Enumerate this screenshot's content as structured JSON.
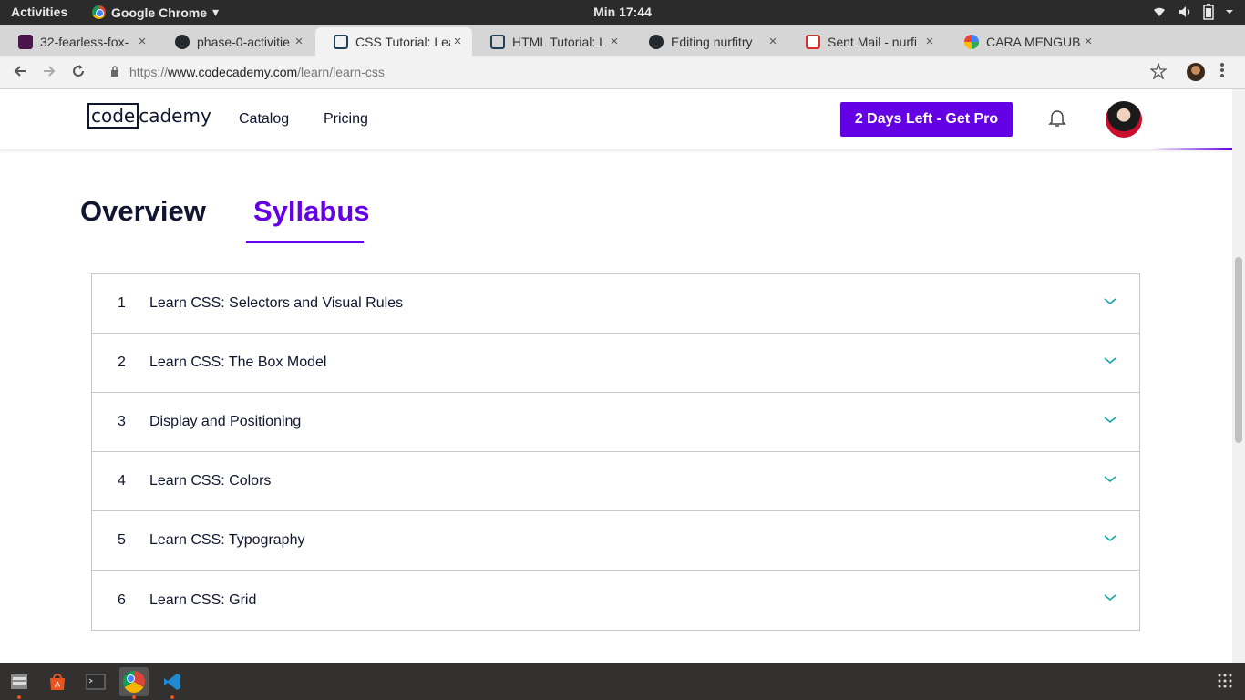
{
  "topbar": {
    "activities": "Activities",
    "app_name": "Google Chrome",
    "app_menu_arrow": "▾",
    "clock": "Min 17:44",
    "icons": [
      "wifi-icon",
      "volume-icon",
      "battery-icon",
      "system-menu-icon"
    ]
  },
  "browser": {
    "tabs": [
      {
        "label": "32-fearless-fox-",
        "icon": "slack-icon"
      },
      {
        "label": "phase-0-activitie",
        "icon": "github-icon"
      },
      {
        "label": "CSS Tutorial: Lea",
        "icon": "codecademy-icon",
        "active": true
      },
      {
        "label": "HTML Tutorial: L",
        "icon": "codecademy-icon"
      },
      {
        "label": "Editing nurfitry",
        "icon": "github-icon"
      },
      {
        "label": "Sent Mail - nurfi",
        "icon": "gmail-icon"
      },
      {
        "label": "CARA MENGUBA",
        "icon": "google-icon"
      }
    ],
    "tab_close": "×",
    "new_tab": "+",
    "url_scheme": "https://",
    "url_host": "www.codecademy.com",
    "url_path": "/learn/learn-css"
  },
  "site": {
    "logo_left": "code",
    "logo_right": "cademy",
    "nav": {
      "catalog": "Catalog",
      "pricing": "Pricing"
    },
    "pro_button": "2 Days Left - Get Pro",
    "accent_color": "#6400e4"
  },
  "course_tabs": {
    "overview": "Overview",
    "syllabus": "Syllabus",
    "active": "Syllabus"
  },
  "syllabus": {
    "modules": [
      {
        "num": "1",
        "title": "Learn CSS: Selectors and Visual Rules"
      },
      {
        "num": "2",
        "title": "Learn CSS: The Box Model"
      },
      {
        "num": "3",
        "title": "Display and Positioning"
      },
      {
        "num": "4",
        "title": "Learn CSS: Colors"
      },
      {
        "num": "5",
        "title": "Learn CSS: Typography"
      },
      {
        "num": "6",
        "title": "Learn CSS: Grid"
      }
    ],
    "chevron_color": "#15a4a4"
  },
  "taskbar": {
    "apps": [
      "files-icon",
      "software-center-icon",
      "terminal-icon",
      "chrome-icon",
      "vscode-icon"
    ],
    "active_app": "chrome-icon"
  }
}
